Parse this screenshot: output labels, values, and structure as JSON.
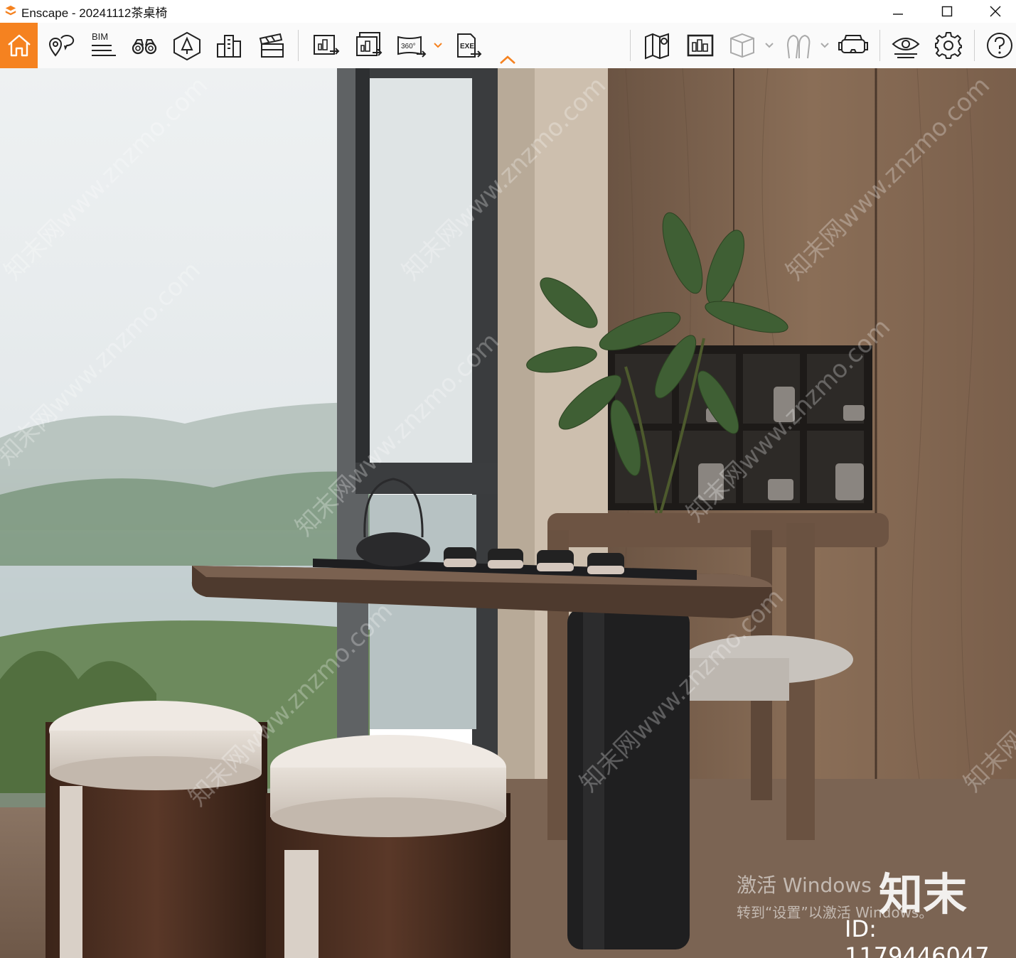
{
  "window": {
    "title": "Enscape - 20241112茶桌椅"
  },
  "toolbar": {
    "bim_label": "BIM",
    "pano_label": "360°",
    "exe_label": "EXE"
  },
  "watermarks": {
    "text": "知末网www.znzmo.com",
    "logo_text": "知末",
    "id_text": "ID: 1179446047"
  },
  "windows_activation": {
    "line1": "激活 Windows",
    "line2": "转到“设置”以激活 Windows。"
  },
  "colors": {
    "accent": "#f58220",
    "toolbar_bg": "#fafafa"
  }
}
